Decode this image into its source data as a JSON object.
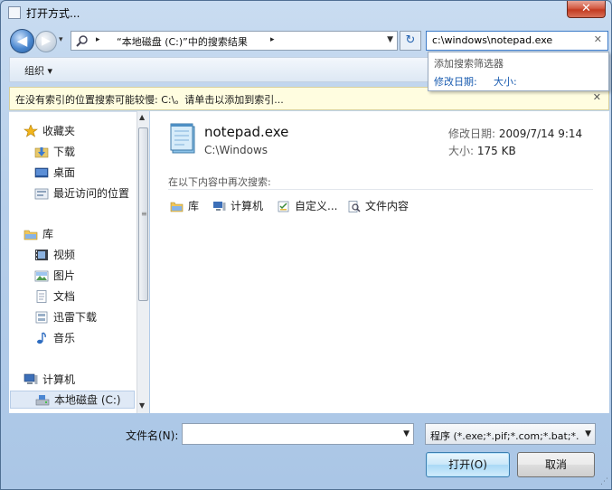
{
  "window": {
    "title": "打开方式...",
    "close_glyph": "✕"
  },
  "nav": {
    "back_glyph": "◀",
    "forward_glyph": "▶",
    "history_glyph": "▾",
    "address_icon": "magnifier-icon",
    "address_sep_glyph": "▸",
    "address_text": "“本地磁盘 (C:)”中的搜索结果",
    "address_dropdown_glyph": "▼",
    "refresh_glyph": "↻",
    "search_value": "c:\\windows\\notepad.exe",
    "search_clear_glyph": "✕"
  },
  "search_dropdown": {
    "title": "添加搜索筛选器",
    "filter_modified": "修改日期:",
    "filter_size": "大小:"
  },
  "toolbar": {
    "organize_label": "组织 ▾"
  },
  "infobar": {
    "text": "在没有索引的位置搜索可能较慢: C:\\。请单击以添加到索引...",
    "close_glyph": "✕"
  },
  "sidebar": {
    "items": [
      {
        "label": "收藏夹",
        "icon": "star-icon"
      },
      {
        "label": "下载",
        "icon": "download-folder-icon"
      },
      {
        "label": "桌面",
        "icon": "desktop-icon"
      },
      {
        "label": "最近访问的位置",
        "icon": "recent-places-icon"
      },
      {
        "label": "库",
        "icon": "libraries-icon"
      },
      {
        "label": "视频",
        "icon": "video-icon"
      },
      {
        "label": "图片",
        "icon": "pictures-icon"
      },
      {
        "label": "文档",
        "icon": "documents-icon"
      },
      {
        "label": "迅雷下载",
        "icon": "thunder-download-icon"
      },
      {
        "label": "音乐",
        "icon": "music-icon"
      },
      {
        "label": "计算机",
        "icon": "computer-icon"
      },
      {
        "label": "本地磁盘 (C:)",
        "icon": "local-disk-icon"
      }
    ],
    "scroll_up_glyph": "▲",
    "scroll_down_glyph": "▼",
    "scroll_grip_glyph": "≡"
  },
  "result": {
    "name": "notepad.exe",
    "path": "C:\\Windows",
    "modified_key": "修改日期:",
    "modified_value": "2009/7/14 9:14",
    "size_key": "大小:",
    "size_value": "175 KB"
  },
  "search_again": {
    "title": "在以下内容中再次搜索:",
    "links": [
      {
        "label": "库",
        "icon": "libraries-icon"
      },
      {
        "label": "计算机",
        "icon": "computer-icon"
      },
      {
        "label": "自定义...",
        "icon": "custom-folder-icon"
      },
      {
        "label": "文件内容",
        "icon": "file-contents-icon"
      }
    ]
  },
  "footer": {
    "filename_label": "文件名(N):",
    "filename_value": "",
    "filename_dropdown_glyph": "▼",
    "filetype_value": "程序 (*.exe;*.pif;*.com;*.bat;*.",
    "filetype_dropdown_glyph": "▼",
    "open_label": "打开(O)",
    "cancel_label": "取消",
    "resize_glyph": "⋰"
  },
  "colors": {
    "accent_blue": "#1a5cb0",
    "infobar_bg": "#fffde0",
    "close_red": "#c23b21"
  }
}
